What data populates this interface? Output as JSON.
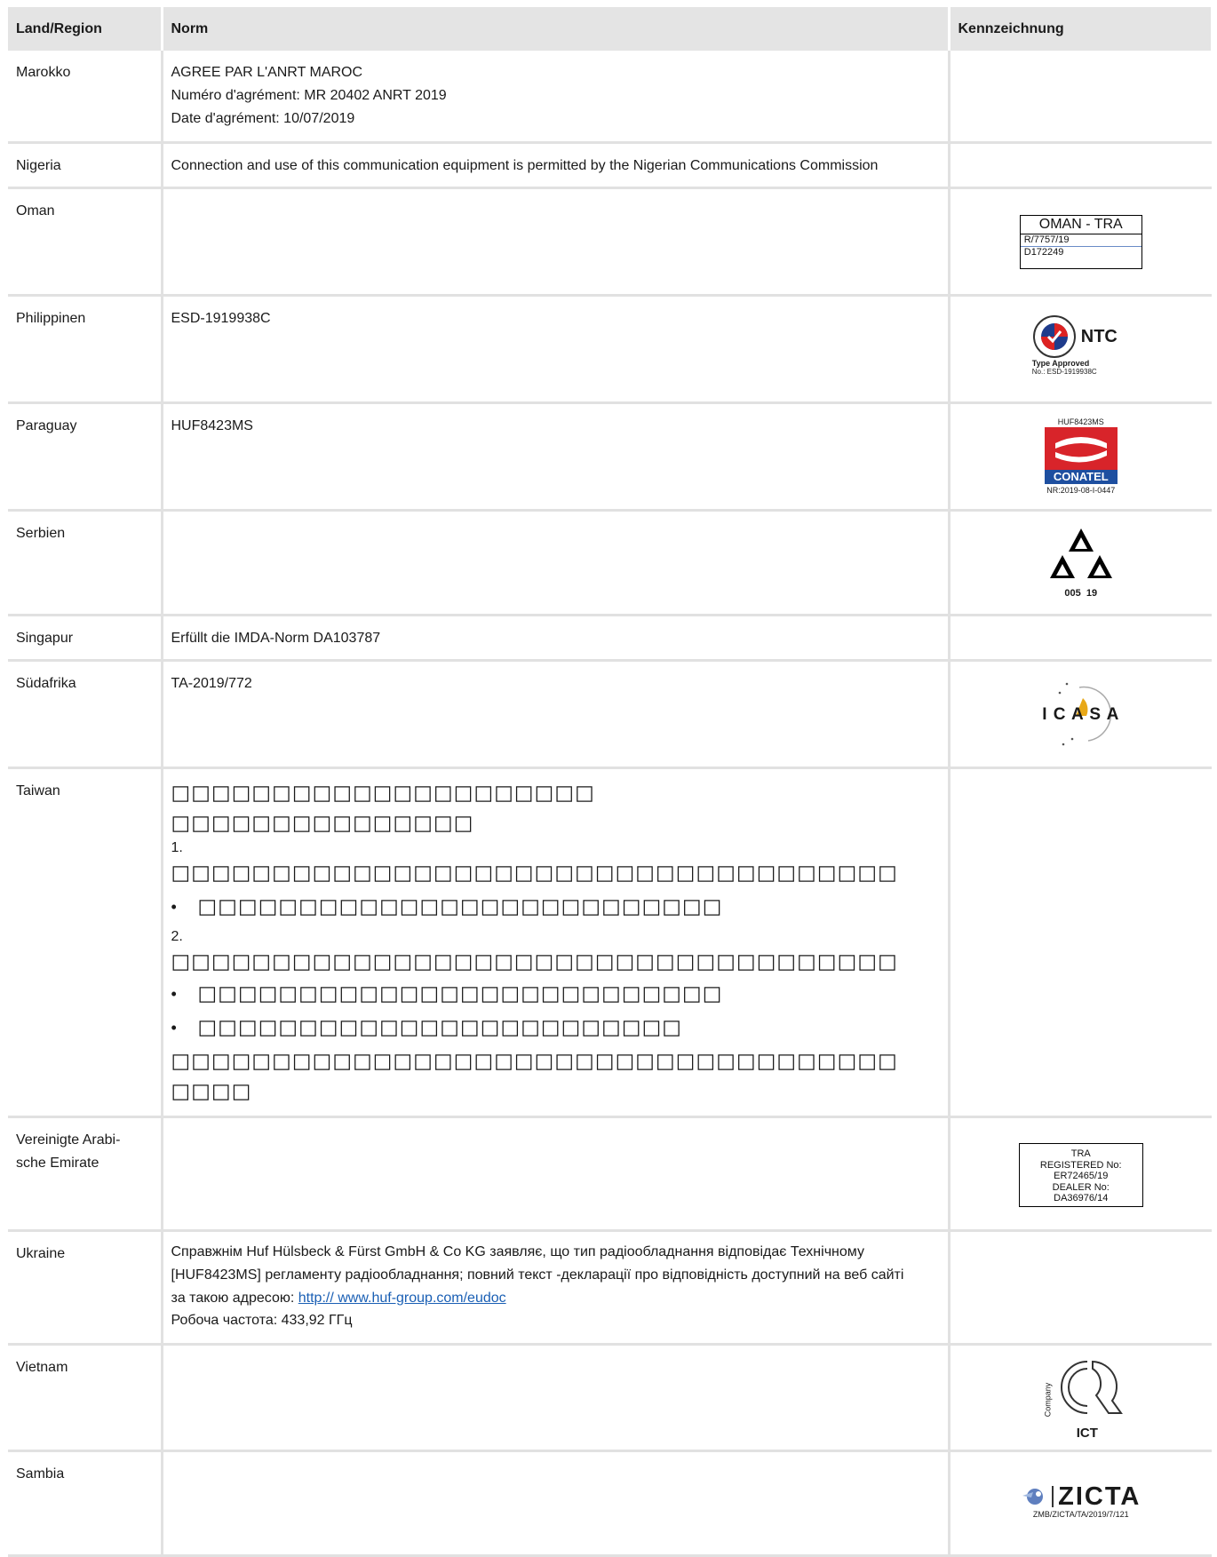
{
  "header": {
    "col_country": "Land/Region",
    "col_norm": "Norm",
    "col_mark": "Kennzeichnung"
  },
  "rows": {
    "morocco": {
      "country": "Marokko",
      "lines": [
        "AGREE PAR L'ANRT MAROC",
        "Numéro d'agrément: MR 20402 ANRT 2019",
        "Date d'agrément: 10/07/2019"
      ]
    },
    "nigeria": {
      "country": "Nigeria",
      "text": "Connection and use of this communication equipment is permitted by the Nigerian Communications Commission"
    },
    "oman": {
      "country": "Oman",
      "label": {
        "title": "OMAN - TRA",
        "line1": "R/7757/19",
        "line2": "D172249"
      }
    },
    "philippines": {
      "country": "Philippinen",
      "text": "ESD-1919938C",
      "logo": {
        "icon": "ntc-seal-icon",
        "name": "NTC",
        "caption1": "Type Approved",
        "caption2": "No.: ESD-1919938C"
      }
    },
    "paraguay": {
      "country": "Paraguay",
      "text": "HUF8423MS",
      "logo": {
        "icon": "conatel-logo-icon",
        "top": "HUF8423MS",
        "name": "CONATEL",
        "bottom": "NR:2019-08-I-0447"
      }
    },
    "serbia": {
      "country": "Serbien",
      "logo": {
        "icon": "serbia-triangle-mark-icon",
        "caption": "005  19"
      }
    },
    "singapore": {
      "country": "Singapur",
      "text": "Erfüllt die IMDA-Norm DA103787"
    },
    "southafrica": {
      "country": "Südafrika",
      "text": "TA-2019/772",
      "logo": {
        "icon": "icasa-logo-icon",
        "name": "I C A S A"
      }
    },
    "taiwan": {
      "country": "Taiwan",
      "lines": [
        "□□□□□□□□□□□□□□□□□□□□□",
        "□□□□□□□□□□□□□□□",
        "1.",
        "□□□□□□□□□□□□□□□□□□□□□□□□□□□□□□□□□□□□",
        "□□□□□□□□□□□□□□□□□□□□□□□□□□",
        "2.",
        "□□□□□□□□□□□□□□□□□□□□□□□□□□□□□□□□□□□□",
        "□□□□□□□□□□□□□□□□□□□□□□□□□□",
        "□□□□□□□□□□□□□□□□□□□□□□□□",
        "□□□□□□□□□□□□□□□□□□□□□□□□□□□□□□□□□□□□",
        "□□□□"
      ],
      "bullet": "•"
    },
    "uae": {
      "country": "Vereinigte Arabi-\nsche Emirate",
      "country_l1": "Vereinigte Arabi-",
      "country_l2": "sche Emirate",
      "label": {
        "l1": "TRA",
        "l2": "REGISTERED No:",
        "l3": "ER72465/19",
        "l4": "DEALER No:",
        "l5": "DA36976/14"
      }
    },
    "ukraine": {
      "country": "Ukraine",
      "l1": "Справжнім Huf Hülsbeck & Fürst GmbH & Co KG заявляє, що тип радіообладнання відповідає Технічному",
      "l2": "[HUF8423MS] регламенту радіообладнання; повний текст -декларації про відповідність доступний на веб сайті",
      "l3_prefix": "за такою адресою: ",
      "link": "http:// www.huf-group.com/eudoc",
      "l4": "Робоча частота: 433,92 ГГц"
    },
    "vietnam": {
      "country": "Vietnam",
      "logo": {
        "icon": "vietnam-cr-mark-icon",
        "side": "Company",
        "name": "ICT"
      }
    },
    "zambia": {
      "country": "Sambia",
      "logo": {
        "icon": "zicta-logo-icon",
        "name": "ZICTA",
        "caption": "ZMB/ZICTA/TA/2019/7/121"
      }
    }
  }
}
